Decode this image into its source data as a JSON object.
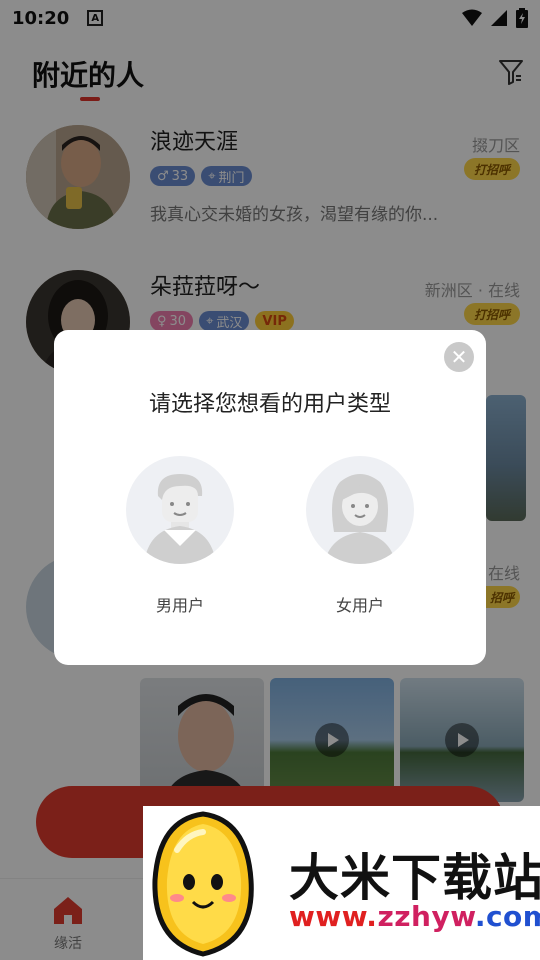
{
  "status_bar": {
    "time": "10:20",
    "a_icon": "A"
  },
  "header": {
    "title": "附近的人"
  },
  "users": [
    {
      "name": "浪迹天涯",
      "location": "掇刀区",
      "age_tag": "33",
      "city_tag": "荆门",
      "greet_label": "打招呼",
      "bio": "我真心交未婚的女孩，渴望有缘的你..."
    },
    {
      "name": "朵菈菈呀～",
      "location": "新洲区 · 在线",
      "age_tag": "30",
      "city_tag": "武汉",
      "vip_tag": "VIP",
      "greet_label": "打招呼"
    }
  ],
  "partial_user": {
    "status": "在线",
    "greet_label": "招呼"
  },
  "modal": {
    "title": "请选择您想看的用户类型",
    "close_symbol": "✕",
    "male_label": "男用户",
    "female_label": "女用户"
  },
  "tab_bar": {
    "home_label": "缘活"
  },
  "watermark": {
    "title": "大米下载站",
    "url_a": "www.",
    "url_b": "zzhyw",
    "url_c": ".com"
  },
  "colors": {
    "accent": "#e03b2e",
    "greet_bg": "#ffd84a",
    "male_tag": "#6b8dd1",
    "female_tag": "#f07fb0"
  },
  "icons": [
    "a-notification-icon",
    "wifi-icon",
    "signal-icon",
    "battery-icon",
    "filter-icon",
    "gender-age-icon",
    "location-pin-icon",
    "close-icon",
    "male-avatar-icon",
    "female-avatar-icon",
    "home-icon",
    "play-icon"
  ]
}
